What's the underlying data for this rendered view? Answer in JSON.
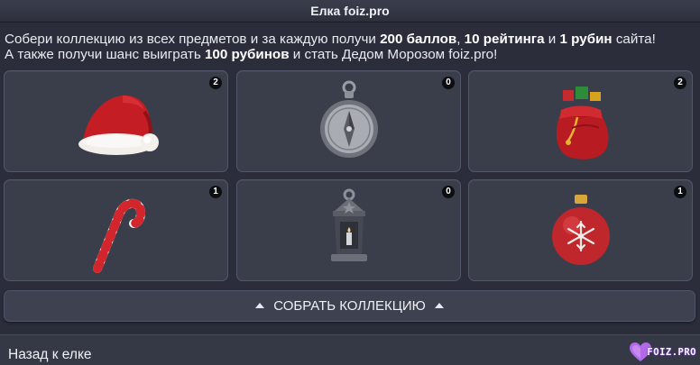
{
  "window": {
    "title": "Елка foiz.pro"
  },
  "intro": {
    "line1_a": "Собери коллекцию из всех предметов и за каждую получи ",
    "line1_b1": "200 баллов",
    "line1_c": ", ",
    "line1_b2": "10 рейтинга",
    "line1_d": " и ",
    "line1_b3": "1 рубин",
    "line1_e": " сайта!",
    "line2_a": "А также получи шанс выиграть ",
    "line2_b": "100 рубинов",
    "line2_c": " и стать Дедом Морозом foiz.pro!"
  },
  "items": [
    {
      "name": "santa-hat",
      "icon": "santa-hat-icon",
      "count": "2"
    },
    {
      "name": "compass",
      "icon": "compass-icon",
      "count": "0"
    },
    {
      "name": "gift-sack",
      "icon": "gift-sack-icon",
      "count": "2"
    },
    {
      "name": "candy-cane",
      "icon": "candy-cane-icon",
      "count": "1"
    },
    {
      "name": "lantern",
      "icon": "lantern-icon",
      "count": "0"
    },
    {
      "name": "ornament-ball",
      "icon": "ornament-ball-icon",
      "count": "1"
    }
  ],
  "actions": {
    "collect_label": "СОБРАТЬ КОЛЛЕКЦИЮ"
  },
  "footer": {
    "back_label": "Назад к елке",
    "logo_text": "FOIZ.PRO"
  },
  "colors": {
    "background": "#2b2e3a",
    "cell": "#3a3d4a",
    "badge": "#0d0e12",
    "accent_red": "#c61f25",
    "logo_purple": "#9b5de5"
  }
}
